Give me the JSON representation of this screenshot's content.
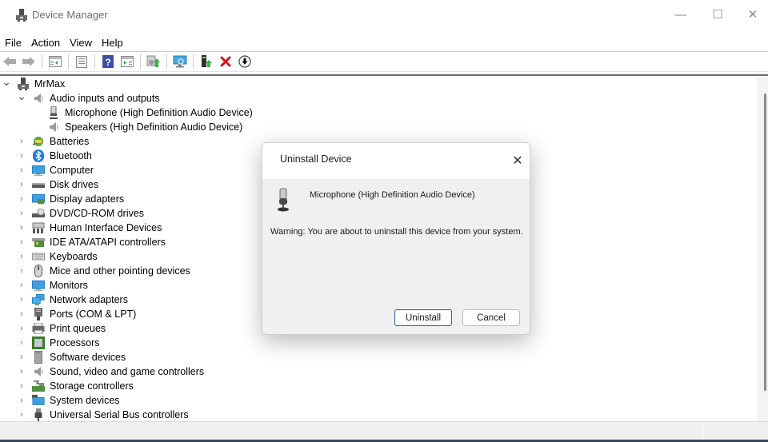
{
  "window": {
    "title": "Device Manager",
    "controls": {
      "minimize": "—",
      "maximize": "☐",
      "close": "✕"
    }
  },
  "menu": [
    "File",
    "Action",
    "View",
    "Help"
  ],
  "toolbar": [
    {
      "icon": "back-arrow-icon"
    },
    {
      "icon": "forward-arrow-icon"
    },
    {
      "sep": true
    },
    {
      "icon": "show-hide-console-tree-icon"
    },
    {
      "sep": true
    },
    {
      "icon": "properties-icon"
    },
    {
      "sep": true
    },
    {
      "icon": "help-icon"
    },
    {
      "icon": "show-action-pane-icon"
    },
    {
      "sep": true
    },
    {
      "icon": "update-driver-icon"
    },
    {
      "sep": true
    },
    {
      "icon": "scan-hardware-changes-icon"
    },
    {
      "sep": true
    },
    {
      "icon": "enable-device-icon"
    },
    {
      "icon": "uninstall-device-icon"
    },
    {
      "icon": "download-driver-icon"
    }
  ],
  "tree": {
    "root": {
      "label": "MrMax",
      "expanded": true,
      "icon": "computer-tower-icon"
    },
    "categories": [
      {
        "label": "Audio inputs and outputs",
        "expanded": true,
        "icon": "speaker-icon",
        "children": [
          {
            "label": "Microphone (High Definition Audio Device)",
            "icon": "microphone-icon"
          },
          {
            "label": "Speakers (High Definition Audio Device)",
            "icon": "speaker-icon"
          }
        ]
      },
      {
        "label": "Batteries",
        "expanded": false,
        "icon": "battery-icon"
      },
      {
        "label": "Bluetooth",
        "expanded": false,
        "icon": "bluetooth-icon"
      },
      {
        "label": "Computer",
        "expanded": false,
        "icon": "computer-icon"
      },
      {
        "label": "Disk drives",
        "expanded": false,
        "icon": "disk-drive-icon"
      },
      {
        "label": "Display adapters",
        "expanded": false,
        "icon": "display-adapter-icon"
      },
      {
        "label": "DVD/CD-ROM drives",
        "expanded": false,
        "icon": "dvd-drive-icon"
      },
      {
        "label": "Human Interface Devices",
        "expanded": false,
        "icon": "hid-icon"
      },
      {
        "label": "IDE ATA/ATAPI controllers",
        "expanded": false,
        "icon": "ide-controller-icon"
      },
      {
        "label": "Keyboards",
        "expanded": false,
        "icon": "keyboard-icon"
      },
      {
        "label": "Mice and other pointing devices",
        "expanded": false,
        "icon": "mouse-icon"
      },
      {
        "label": "Monitors",
        "expanded": false,
        "icon": "monitor-icon"
      },
      {
        "label": "Network adapters",
        "expanded": false,
        "icon": "network-adapter-icon"
      },
      {
        "label": "Ports (COM & LPT)",
        "expanded": false,
        "icon": "port-icon"
      },
      {
        "label": "Print queues",
        "expanded": false,
        "icon": "printer-icon"
      },
      {
        "label": "Processors",
        "expanded": false,
        "icon": "processor-icon"
      },
      {
        "label": "Software devices",
        "expanded": false,
        "icon": "software-device-icon"
      },
      {
        "label": "Sound, video and game controllers",
        "expanded": false,
        "icon": "speaker-icon"
      },
      {
        "label": "Storage controllers",
        "expanded": false,
        "icon": "storage-controller-icon"
      },
      {
        "label": "System devices",
        "expanded": false,
        "icon": "system-devices-icon"
      },
      {
        "label": "Universal Serial Bus controllers",
        "expanded": false,
        "icon": "usb-icon"
      }
    ]
  },
  "dialog": {
    "title": "Uninstall Device",
    "device_name": "Microphone (High Definition Audio Device)",
    "warning": "Warning: You are about to uninstall this device from your system.",
    "buttons": {
      "uninstall": "Uninstall",
      "cancel": "Cancel"
    },
    "close": "✕"
  }
}
